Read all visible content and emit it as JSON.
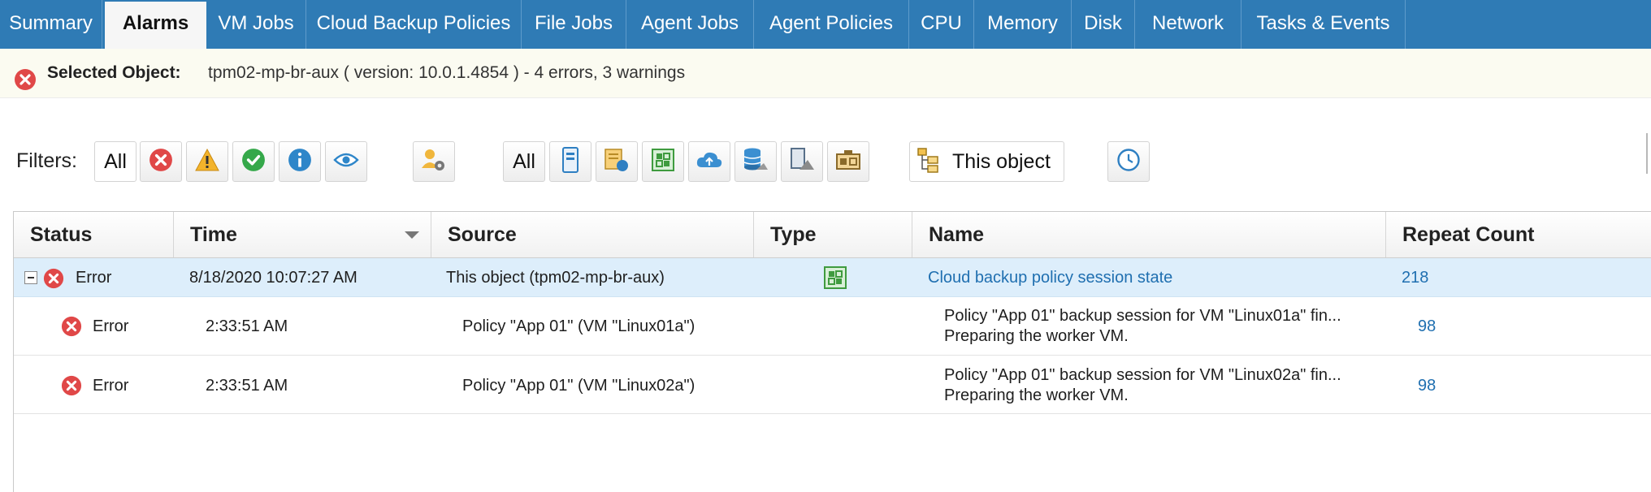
{
  "tabs": [
    {
      "label": "Summary",
      "active": false
    },
    {
      "label": "Alarms",
      "active": true
    },
    {
      "label": "VM Jobs",
      "active": false
    },
    {
      "label": "Cloud Backup Policies",
      "active": false
    },
    {
      "label": "File Jobs",
      "active": false
    },
    {
      "label": "Agent Jobs",
      "active": false
    },
    {
      "label": "Agent Policies",
      "active": false
    },
    {
      "label": "CPU",
      "active": false
    },
    {
      "label": "Memory",
      "active": false
    },
    {
      "label": "Disk",
      "active": false
    },
    {
      "label": "Network",
      "active": false
    },
    {
      "label": "Tasks & Events",
      "active": false
    }
  ],
  "selected": {
    "label": "Selected Object:",
    "value": "tpm02-mp-br-aux ( version: 10.0.1.4854 ) - 4 errors, 3 warnings",
    "icon": "error-icon"
  },
  "filters": {
    "label": "Filters:",
    "status_all": "All",
    "type_all": "All",
    "scope": "This object",
    "status_icons": [
      "error-icon",
      "warning-icon",
      "success-icon",
      "info-icon",
      "watch-icon"
    ],
    "type_icons": [
      "vm-icon",
      "cloud-backup-policy-icon",
      "file-job-icon",
      "cloud-icon",
      "storage-icon",
      "agent-icon",
      "proxy-icon"
    ]
  },
  "grid": {
    "columns": [
      "Status",
      "Time",
      "Source",
      "Type",
      "Name",
      "Repeat Count"
    ],
    "sort_column": "Time",
    "rows": [
      {
        "level": "parent",
        "expanded": true,
        "status": "Error",
        "time": "8/18/2020 10:07:27 AM",
        "source": "This object (tpm02-mp-br-aux)",
        "type_icon": "cloud-backup-policy-icon",
        "name": "Cloud backup policy session state",
        "repeat": "218"
      },
      {
        "level": "child",
        "status": "Error",
        "time": "2:33:51 AM",
        "source": "Policy \"App 01\" (VM \"Linux01a\")",
        "name_line1": "Policy \"App 01\" backup session for VM \"Linux01a\" fin...",
        "name_line2": "Preparing the worker VM.",
        "repeat": "98"
      },
      {
        "level": "child",
        "status": "Error",
        "time": "2:33:51 AM",
        "source": "Policy \"App 01\" (VM \"Linux02a\")",
        "name_line1": "Policy \"App 01\" backup session for VM \"Linux02a\" fin...",
        "name_line2": "Preparing the worker VM.",
        "repeat": "98"
      }
    ]
  },
  "colors": {
    "tabbar": "#2f7bb5",
    "error": "#e04848",
    "link": "#1f6fb0",
    "row_selected": "#ddeefb"
  }
}
